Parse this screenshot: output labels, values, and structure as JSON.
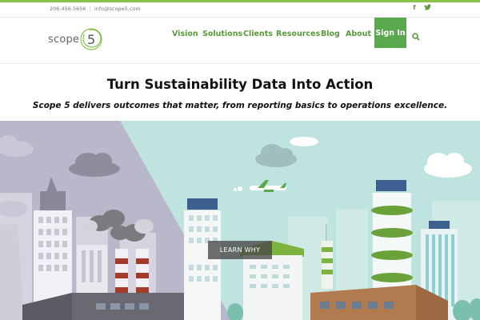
{
  "topbar": {
    "phone": "206.456.5656",
    "separator": "|",
    "email": "info@scope5.com",
    "social_icons": [
      "facebook-icon",
      "twitter-icon"
    ]
  },
  "header": {
    "logo_word": "scope",
    "logo_number": "5",
    "nav": [
      "Vision",
      "Solutions",
      "Clients",
      "Resources",
      "Blog",
      "About"
    ],
    "signin_label": "Sign In",
    "search_icon": "search-icon"
  },
  "hero": {
    "title": "Turn Sustainability Data Into Action",
    "subtitle": "Scope 5 delivers outcomes that matter, from reporting basics to operations excellence.",
    "cta_label": "LEARN WHY"
  },
  "colors": {
    "accent": "#5aa84e",
    "nav_text": "#5a9a3c",
    "topbar_line": "#8bc34a",
    "sky_left": "#b7b6c9",
    "sky_right": "#bfe3df"
  }
}
